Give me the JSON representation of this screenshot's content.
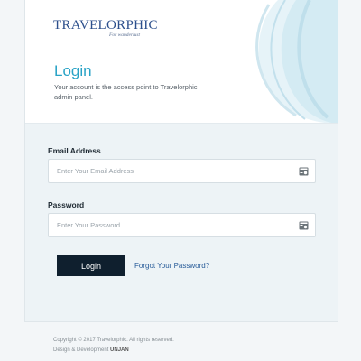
{
  "brand": {
    "logo_text": "TRAVELORPHIC",
    "tagline": "For wanderlust",
    "color": "#2c4f8c"
  },
  "login": {
    "title": "Login",
    "subtitle": "Your account is the access point to Travelorphic admin panel.",
    "accent_color": "#29a3c6"
  },
  "form": {
    "email": {
      "label": "Email Address",
      "placeholder": "Enter Your Email Address",
      "value": "",
      "icon": "contact-card-icon"
    },
    "password": {
      "label": "Password",
      "placeholder": "Enter Your Password",
      "value": "",
      "icon": "contact-card-icon"
    },
    "login_button": "Login",
    "forgot_link": "Forgot Your Password?"
  },
  "footer": {
    "copyright": "Copyright © 2017 Travelorphic. All rights reserved.",
    "credit_prefix": "Design & Development",
    "credit_brand": "UNJAN"
  }
}
